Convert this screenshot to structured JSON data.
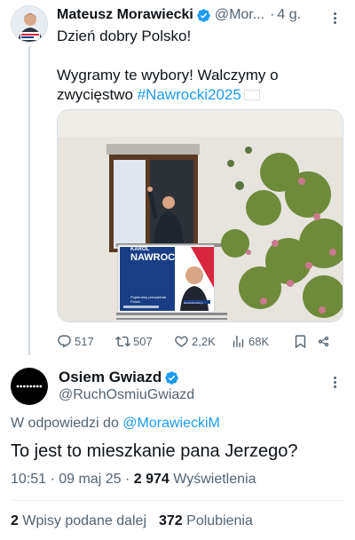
{
  "post": {
    "author_name": "Mateusz Morawiecki",
    "author_handle": "@Mor...",
    "separator": "·",
    "time": "4 g.",
    "line1": "Dzień dobry Polsko!",
    "line2_text": "Wygramy te wybory! Walczymy o zwycięstwo ",
    "hashtag": "#Nawrocki2025",
    "banner": {
      "small_label": "KAROL",
      "name": "NAWROCKI",
      "tagline": "Popieramy prezydenta Polski",
      "url": "karolnawrocki.pl"
    },
    "actions": {
      "replies": "517",
      "reposts": "507",
      "likes": "2,2K",
      "views": "68K"
    }
  },
  "reply": {
    "author_name": "Osiem Gwiazd",
    "author_handle": "@RuchOsmiuGwiazd",
    "reply_prefix": "W odpowiedzi do ",
    "reply_mention": "@MorawieckiM",
    "text": "To jest to mieszkanie pana Jerzego?",
    "time_date": "10:51 · 09 maj 25 · ",
    "views_count": "2 974",
    "views_label": " Wyświetlenia",
    "reposts_count": "2",
    "reposts_label": " Wpisy podane dalej",
    "likes_count": "372",
    "likes_label": " Polubienia"
  },
  "colors": {
    "accent": "#1d9bf0",
    "text": "#0f1419",
    "muted": "#536471",
    "verified": "#1d9bf0"
  },
  "icons": [
    "verified-badge-icon",
    "more-icon",
    "reply-icon",
    "repost-icon",
    "like-icon",
    "views-icon",
    "bookmark-icon",
    "share-icon",
    "poland-flag-icon"
  ]
}
